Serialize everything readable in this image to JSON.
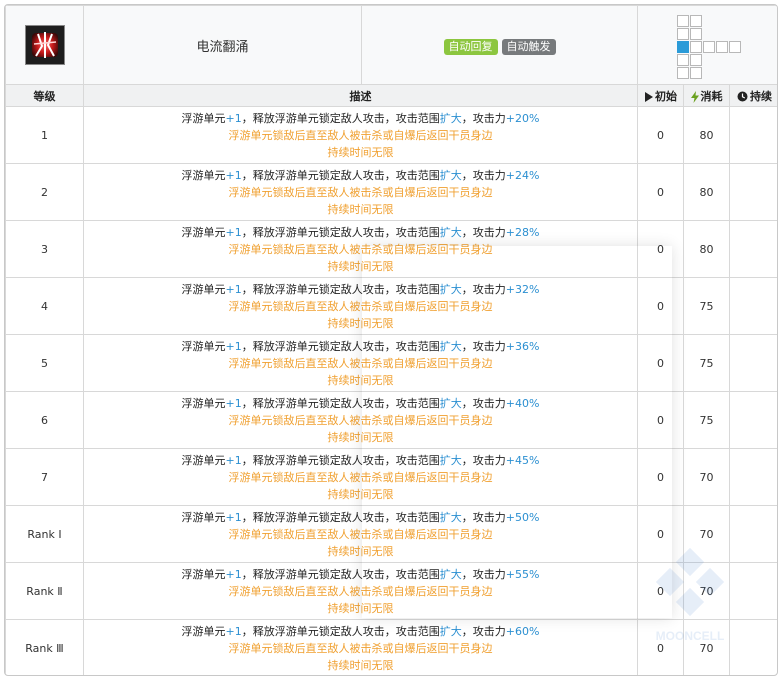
{
  "skill": {
    "name": "电流翻涌",
    "tags": [
      {
        "label": "自动回复",
        "color": "#8cc63f"
      },
      {
        "label": "自动触发",
        "color": "#777a7c"
      }
    ]
  },
  "range_grid": [
    [
      1,
      1,
      0,
      0,
      0
    ],
    [
      1,
      1,
      0,
      0,
      0
    ],
    [
      2,
      1,
      1,
      1,
      1
    ],
    [
      1,
      1,
      0,
      0,
      0
    ],
    [
      1,
      1,
      0,
      0,
      0
    ]
  ],
  "headers": {
    "level": "等级",
    "desc": "描述",
    "initial": "初始",
    "cost": "消耗",
    "duration": "持续"
  },
  "colors": {
    "blue": "#2b8fd1",
    "orange": "#f0a030",
    "selected": "#2b9bd8"
  },
  "rows": [
    {
      "level": "1",
      "desc": {
        "a": "浮游单元",
        "b": "+1",
        "c": "，释放浮游单元锁定敌人攻击，攻击范围",
        "d": "扩大",
        "e": "，攻击力",
        "f": "+20%",
        "g": "浮游单元锁敌后直至敌人被击杀或自爆后返回干员身边",
        "h": "持续时间无限"
      },
      "initial": "0",
      "cost": "80"
    },
    {
      "level": "2",
      "desc": {
        "a": "浮游单元",
        "b": "+1",
        "c": "，释放浮游单元锁定敌人攻击，攻击范围",
        "d": "扩大",
        "e": "，攻击力",
        "f": "+24%",
        "g": "浮游单元锁敌后直至敌人被击杀或自爆后返回干员身边",
        "h": "持续时间无限"
      },
      "initial": "0",
      "cost": "80"
    },
    {
      "level": "3",
      "desc": {
        "a": "浮游单元",
        "b": "+1",
        "c": "，释放浮游单元锁定敌人攻击，攻击范围",
        "d": "扩大",
        "e": "，攻击力",
        "f": "+28%",
        "g": "浮游单元锁敌后直至敌人被击杀或自爆后返回干员身边",
        "h": "持续时间无限"
      },
      "initial": "0",
      "cost": "80"
    },
    {
      "level": "4",
      "desc": {
        "a": "浮游单元",
        "b": "+1",
        "c": "，释放浮游单元锁定敌人攻击，攻击范围",
        "d": "扩大",
        "e": "，攻击力",
        "f": "+32%",
        "g": "浮游单元锁敌后直至敌人被击杀或自爆后返回干员身边",
        "h": "持续时间无限"
      },
      "initial": "0",
      "cost": "75"
    },
    {
      "level": "5",
      "desc": {
        "a": "浮游单元",
        "b": "+1",
        "c": "，释放浮游单元锁定敌人攻击，攻击范围",
        "d": "扩大",
        "e": "，攻击力",
        "f": "+36%",
        "g": "浮游单元锁敌后直至敌人被击杀或自爆后返回干员身边",
        "h": "持续时间无限"
      },
      "initial": "0",
      "cost": "75"
    },
    {
      "level": "6",
      "desc": {
        "a": "浮游单元",
        "b": "+1",
        "c": "，释放浮游单元锁定敌人攻击，攻击范围",
        "d": "扩大",
        "e": "，攻击力",
        "f": "+40%",
        "g": "浮游单元锁敌后直至敌人被击杀或自爆后返回干员身边",
        "h": "持续时间无限"
      },
      "initial": "0",
      "cost": "75"
    },
    {
      "level": "7",
      "desc": {
        "a": "浮游单元",
        "b": "+1",
        "c": "，释放浮游单元锁定敌人攻击，攻击范围",
        "d": "扩大",
        "e": "，攻击力",
        "f": "+45%",
        "g": "浮游单元锁敌后直至敌人被击杀或自爆后返回干员身边",
        "h": "持续时间无限"
      },
      "initial": "0",
      "cost": "70"
    },
    {
      "level": "Rank Ⅰ",
      "desc": {
        "a": "浮游单元",
        "b": "+1",
        "c": "，释放浮游单元锁定敌人攻击，攻击范围",
        "d": "扩大",
        "e": "，攻击力",
        "f": "+50%",
        "g": "浮游单元锁敌后直至敌人被击杀或自爆后返回干员身边",
        "h": "持续时间无限"
      },
      "initial": "0",
      "cost": "70"
    },
    {
      "level": "Rank Ⅱ",
      "desc": {
        "a": "浮游单元",
        "b": "+1",
        "c": "，释放浮游单元锁定敌人攻击，攻击范围",
        "d": "扩大",
        "e": "，攻击力",
        "f": "+55%",
        "g": "浮游单元锁敌后直至敌人被击杀或自爆后返回干员身边",
        "h": "持续时间无限"
      },
      "initial": "0",
      "cost": "70"
    },
    {
      "level": "Rank Ⅲ",
      "desc": {
        "a": "浮游单元",
        "b": "+1",
        "c": "，释放浮游单元锁定敌人攻击，攻击范围",
        "d": "扩大",
        "e": "，攻击力",
        "f": "+60%",
        "g": "浮游单元锁敌后直至敌人被击杀或自爆后返回干员身边",
        "h": "持续时间无限"
      },
      "initial": "0",
      "cost": "70"
    }
  ],
  "icons": {
    "skill": "skill-icon",
    "initial": "play-icon",
    "cost": "lightning-icon",
    "duration": "clock-icon"
  },
  "watermark": {
    "text": "MOONCELL"
  }
}
